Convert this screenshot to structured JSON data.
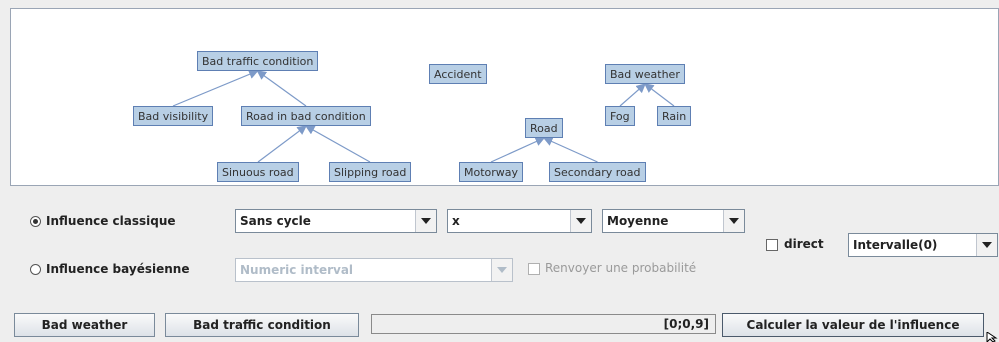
{
  "graph": {
    "nodes": [
      {
        "id": "bad_traffic",
        "label": "Bad traffic condition"
      },
      {
        "id": "accident",
        "label": "Accident"
      },
      {
        "id": "bad_weather",
        "label": "Bad weather"
      },
      {
        "id": "bad_visibility",
        "label": "Bad visibility"
      },
      {
        "id": "road_bad",
        "label": "Road in bad condition"
      },
      {
        "id": "fog",
        "label": "Fog"
      },
      {
        "id": "rain",
        "label": "Rain"
      },
      {
        "id": "road",
        "label": "Road"
      },
      {
        "id": "sinuous",
        "label": "Sinuous road"
      },
      {
        "id": "slipping",
        "label": "Slipping road"
      },
      {
        "id": "motorway",
        "label": "Motorway"
      },
      {
        "id": "secondary",
        "label": "Secondary road"
      }
    ],
    "edges": [
      {
        "from": "bad_visibility",
        "to": "bad_traffic"
      },
      {
        "from": "road_bad",
        "to": "bad_traffic"
      },
      {
        "from": "sinuous",
        "to": "road_bad"
      },
      {
        "from": "slipping",
        "to": "road_bad"
      },
      {
        "from": "fog",
        "to": "bad_weather"
      },
      {
        "from": "rain",
        "to": "bad_weather"
      },
      {
        "from": "motorway",
        "to": "road"
      },
      {
        "from": "secondary",
        "to": "road"
      }
    ]
  },
  "controls": {
    "influence_classique": {
      "label": "Influence classique",
      "selected": true
    },
    "influence_bayesienne": {
      "label": "Influence bayésienne",
      "selected": false
    },
    "cycle_combo": "Sans cycle",
    "operator_combo": "x",
    "aggregate_combo": "Moyenne",
    "direct_label": "direct",
    "direct_checked": false,
    "interval_combo": "Intervalle(0)",
    "numeric_interval_combo": "Numeric interval",
    "renvoyer_label": "Renvoyer une probabilité",
    "renvoyer_checked": false
  },
  "footer": {
    "source_button": "Bad weather",
    "target_button": "Bad traffic condition",
    "progress_text": "[0;0,9]",
    "compute_button": "Calculer la valeur de l'influence"
  },
  "colors": {
    "node_fill": "#b8cfe5",
    "node_border": "#5e7fb3",
    "edge": "#7d9ac8"
  }
}
